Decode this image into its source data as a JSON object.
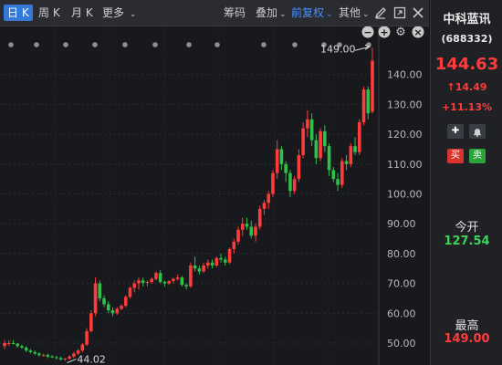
{
  "toolbar": {
    "tabs": [
      {
        "label": "日 K",
        "active": true
      },
      {
        "label": "周 K",
        "active": false
      },
      {
        "label": "月 K",
        "active": false
      }
    ],
    "more_label": "更多",
    "tools": [
      {
        "label": "筹码",
        "active": false
      },
      {
        "label": "叠加",
        "active": false
      },
      {
        "label": "前复权",
        "active": true
      },
      {
        "label": "其他",
        "active": false
      }
    ],
    "icons": [
      "pencil-icon",
      "expand-icon",
      "close-icon"
    ]
  },
  "chart_controls": [
    "minus-icon",
    "plus-icon",
    "gear-icon",
    "close-icon"
  ],
  "stock": {
    "name": "中科蓝讯",
    "code": "(688332)",
    "price": "144.63",
    "change": "14.49",
    "change_pct": "+11.13%",
    "buy_label": "买",
    "sell_label": "卖",
    "open_label": "今开",
    "open_value": "127.54",
    "high_label": "最高",
    "high_value": "149.00"
  },
  "colors": {
    "up": "#ff3b3b",
    "down": "#2fbf4a",
    "accent": "#3478d8"
  },
  "chart_data": {
    "type": "candlestick",
    "y_axis_ticks": [
      50,
      60,
      70,
      80,
      90,
      100,
      110,
      120,
      130,
      140
    ],
    "ylim": [
      46,
      152
    ],
    "grid": true,
    "annotations": [
      {
        "label": "149.00",
        "note": "high"
      },
      {
        "label": "44.02",
        "note": "low"
      }
    ],
    "candles": [
      [
        49,
        51,
        48,
        50
      ],
      [
        50,
        51,
        49,
        50
      ],
      [
        50,
        51,
        49.5,
        49.8
      ],
      [
        49.8,
        50,
        48.5,
        49
      ],
      [
        49,
        49.5,
        48,
        48.5
      ],
      [
        48.5,
        49,
        47,
        47.5
      ],
      [
        47.5,
        48,
        46.5,
        47
      ],
      [
        47,
        47.5,
        46,
        46.5
      ],
      [
        46.5,
        47,
        45.5,
        46
      ],
      [
        46,
        46.5,
        45.5,
        46
      ],
      [
        46,
        46.5,
        45,
        45.5
      ],
      [
        45.5,
        46,
        45,
        45.3
      ],
      [
        45.3,
        45.8,
        44.5,
        45
      ],
      [
        45,
        45.5,
        44.2,
        44.5
      ],
      [
        44.5,
        45,
        44.02,
        44.8
      ],
      [
        44.8,
        46,
        44.5,
        45.5
      ],
      [
        45.5,
        47,
        45,
        46.5
      ],
      [
        46.5,
        48,
        46,
        47.5
      ],
      [
        47.5,
        50,
        47,
        49.5
      ],
      [
        49.5,
        55,
        49,
        54
      ],
      [
        54,
        61,
        53.5,
        60
      ],
      [
        60,
        72,
        59,
        70
      ],
      [
        70,
        71,
        64,
        65
      ],
      [
        65,
        66,
        62,
        63
      ],
      [
        63,
        64,
        60,
        61
      ],
      [
        61,
        62,
        59,
        60
      ],
      [
        60,
        62,
        59.5,
        61.5
      ],
      [
        61.5,
        63,
        61,
        62.5
      ],
      [
        62.5,
        66,
        62,
        65.5
      ],
      [
        65.5,
        69,
        65,
        68.5
      ],
      [
        68.5,
        71,
        67,
        70
      ],
      [
        70,
        72,
        68,
        71
      ],
      [
        71,
        72,
        69,
        70.2
      ],
      [
        70.2,
        71,
        69,
        70.5
      ],
      [
        70.5,
        72,
        70,
        71.5
      ],
      [
        71.5,
        74,
        71,
        73.5
      ],
      [
        73.5,
        74.5,
        70,
        70.5
      ],
      [
        70.5,
        71,
        69,
        70
      ],
      [
        70,
        71,
        69.5,
        70.8
      ],
      [
        70.8,
        72,
        70,
        71.5
      ],
      [
        71.5,
        73,
        71,
        72
      ],
      [
        72,
        72.5,
        69,
        69.5
      ],
      [
        69.5,
        70,
        68,
        69
      ],
      [
        69,
        77,
        68.5,
        76
      ],
      [
        76,
        79,
        74,
        75
      ],
      [
        75,
        76,
        73,
        74
      ],
      [
        74,
        77,
        73.5,
        76
      ],
      [
        76,
        78,
        75,
        77
      ],
      [
        77,
        78,
        75,
        76
      ],
      [
        76,
        79,
        75.5,
        78.5
      ],
      [
        78.5,
        80,
        77,
        78
      ],
      [
        78,
        79,
        76,
        77
      ],
      [
        77,
        82,
        76.5,
        81.5
      ],
      [
        81.5,
        85,
        80,
        84
      ],
      [
        84,
        89,
        83,
        88
      ],
      [
        88,
        92,
        86,
        90
      ],
      [
        90,
        92,
        88,
        89
      ],
      [
        89,
        91,
        85,
        86
      ],
      [
        86,
        90,
        84,
        89
      ],
      [
        89,
        96,
        88,
        95
      ],
      [
        95,
        98,
        93,
        97
      ],
      [
        97,
        101,
        95,
        100
      ],
      [
        100,
        108,
        99,
        107
      ],
      [
        107,
        118,
        105,
        115
      ],
      [
        115,
        116,
        108,
        110
      ],
      [
        110,
        111,
        104,
        107
      ],
      [
        107,
        108,
        99,
        101
      ],
      [
        101,
        106,
        100,
        105
      ],
      [
        105,
        115,
        104,
        113
      ],
      [
        113,
        124,
        112,
        122
      ],
      [
        122,
        128,
        119,
        125
      ],
      [
        125,
        127,
        116,
        118
      ],
      [
        118,
        120,
        110,
        112
      ],
      [
        112,
        122,
        111,
        121
      ],
      [
        121,
        123,
        114,
        116
      ],
      [
        116,
        117,
        106,
        108
      ],
      [
        108,
        109,
        104,
        105
      ],
      [
        105,
        107,
        101,
        103
      ],
      [
        103,
        112,
        102,
        111
      ],
      [
        111,
        113,
        108,
        110
      ],
      [
        110,
        117,
        109,
        116
      ],
      [
        116,
        119,
        113,
        114
      ],
      [
        114,
        125,
        113,
        124
      ],
      [
        124,
        136,
        123,
        135
      ],
      [
        135,
        136,
        125,
        127
      ],
      [
        127.54,
        149,
        127,
        144.63
      ]
    ]
  }
}
